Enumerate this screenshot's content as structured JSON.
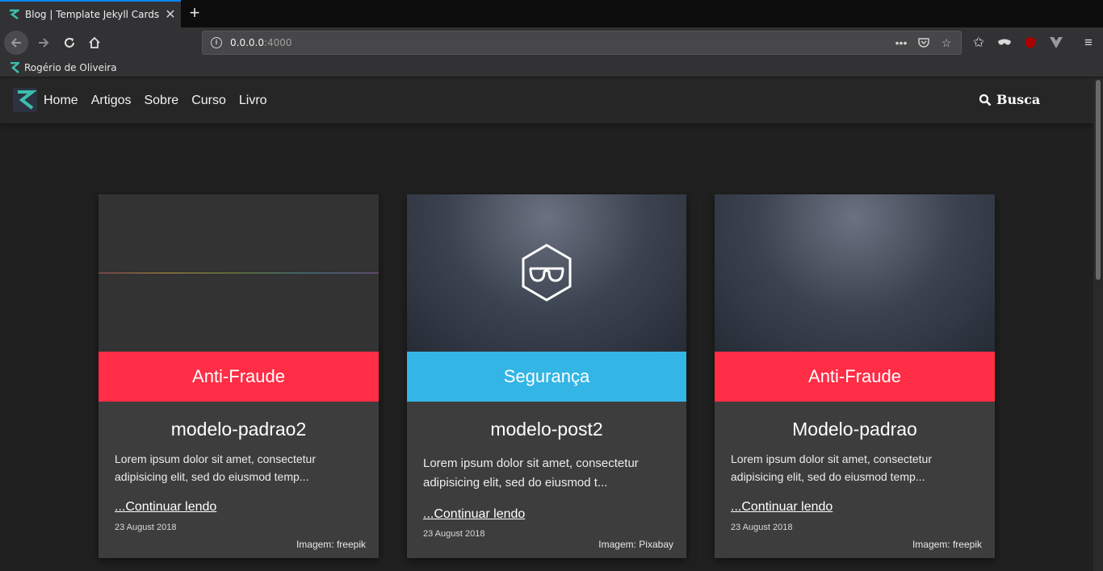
{
  "browser": {
    "tab_title": "Blog | Template Jekyll Cards",
    "tab_close": "✕",
    "new_tab": "+",
    "url_host": "0.0.0.0",
    "url_port": ":4000",
    "bookmark": "Rogério de Oliveira",
    "accent": "#0a84ff"
  },
  "site": {
    "nav": [
      "Home",
      "Artigos",
      "Sobre",
      "Curso",
      "Livro"
    ],
    "search_label": "Busca",
    "logo_color": "#3bbfad"
  },
  "cards": [
    {
      "category": "Anti-Fraude",
      "category_color": "#ff2d45",
      "title": "modelo-padrao2",
      "excerpt": "Lorem ipsum dolor sit amet, consectetur adipisicing elit, sed do eiusmod temp...",
      "more": "...Continuar lendo",
      "date": "23 August 2018",
      "credit": "Imagem: freepik"
    },
    {
      "category": "Segurança",
      "category_color": "#33b5e5",
      "title": "modelo-post2",
      "excerpt": "Lorem ipsum dolor sit amet, consectetur adipisicing elit, sed do eiusmod t...",
      "more": "...Continuar lendo",
      "date": "23 August 2018",
      "credit": "Imagem: Pixabay"
    },
    {
      "category": "Anti-Fraude",
      "category_color": "#ff2d45",
      "title": "Modelo-padrao",
      "excerpt": "Lorem ipsum dolor sit amet, consectetur adipisicing elit, sed do eiusmod temp...",
      "more": "...Continuar lendo",
      "date": "23 August 2018",
      "credit": "Imagem: freepik"
    }
  ]
}
